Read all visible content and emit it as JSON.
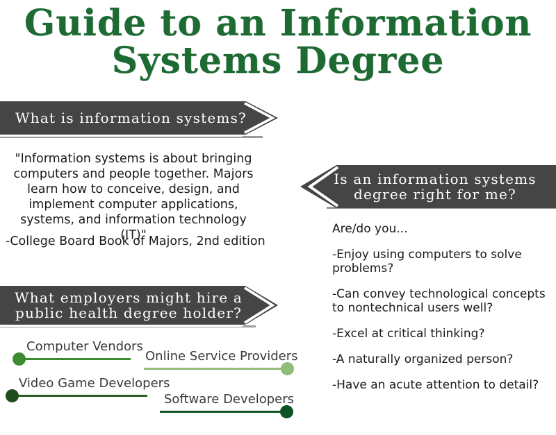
{
  "title": {
    "line1": "Guide to an Information",
    "line2": "Systems Degree",
    "color": "#1d6b33"
  },
  "banners": {
    "what_is": {
      "text": "What is information systems?",
      "direction": "right",
      "bg": "#454545",
      "text_color": "#ffffff"
    },
    "right_for_me": {
      "text": "Is an information systems\ndegree right for me?",
      "direction": "left",
      "bg": "#454545",
      "text_color": "#ffffff"
    },
    "employers": {
      "text": "What employers might hire a\npublic health degree holder?",
      "direction": "right",
      "bg": "#454545",
      "text_color": "#ffffff"
    }
  },
  "definition": {
    "quote": "\"Information systems is about bringing computers and people together. Majors learn how to conceive, design, and implement computer applications, systems, and information technology (IT)\"",
    "attribution": "-College Board Book of Majors, 2nd edition"
  },
  "checklist": {
    "lead": "Are/do you...",
    "items": [
      "-Enjoy using computers to solve problems?",
      "-Can convey technological concepts to nontechnical users well?",
      "-Excel at critical thinking?",
      "-A naturally organized person?",
      "-Have an acute attention to detail?"
    ]
  },
  "employers": {
    "items": [
      {
        "label": "Computer Vendors",
        "dot_color": "#3e8a32",
        "line_color": "#3e8a32",
        "dot_side": "left"
      },
      {
        "label": "Online Service Providers",
        "dot_color": "#8fbc78",
        "line_color": "#8fbc78",
        "dot_side": "right"
      },
      {
        "label": "Video Game Developers",
        "dot_color": "#1d4d1d",
        "line_color": "#2c5e22",
        "dot_side": "left"
      },
      {
        "label": "Software Developers",
        "dot_color": "#0f5223",
        "line_color": "#0f5223",
        "dot_side": "right"
      }
    ]
  }
}
